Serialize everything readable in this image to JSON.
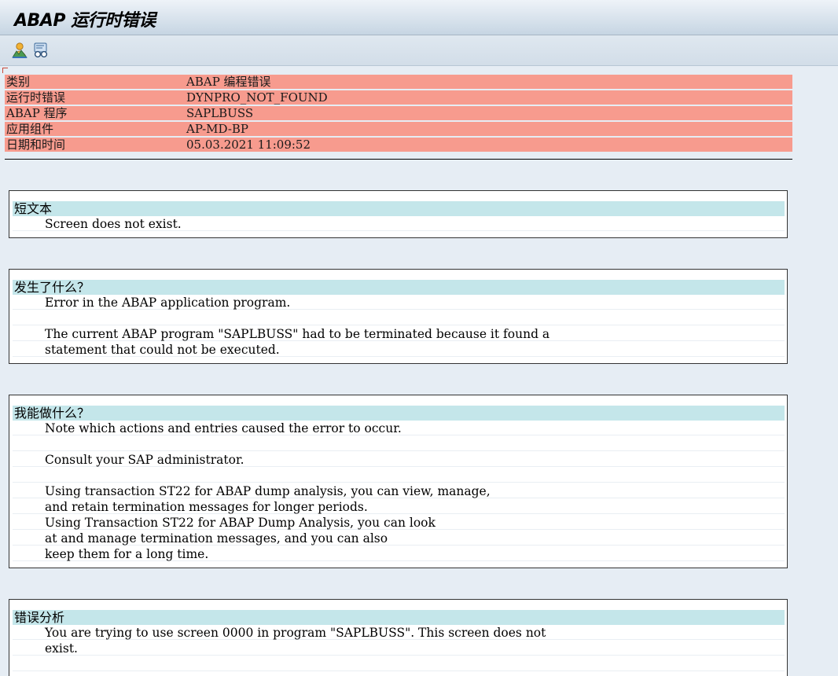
{
  "window": {
    "title": "ABAP 运行时错误"
  },
  "toolbar": {
    "buttons": [
      {
        "icon": "user-tree-icon"
      },
      {
        "icon": "glasses-display-icon"
      }
    ]
  },
  "header": {
    "rows": [
      {
        "key": "类别",
        "value": "ABAP 编程错误"
      },
      {
        "key": "运行时错误",
        "value": "DYNPRO_NOT_FOUND"
      },
      {
        "key": "ABAP 程序",
        "value": "SAPLBUSS"
      },
      {
        "key": "应用组件",
        "value": "AP-MD-BP"
      },
      {
        "key": "日期和时间",
        "value": "05.03.2021 11:09:52"
      }
    ]
  },
  "sections": [
    {
      "title": "短文本",
      "lines": [
        "Screen does not exist."
      ]
    },
    {
      "title": "发生了什么？",
      "lines": [
        "Error in the ABAP application program.",
        "",
        "The current ABAP program \"SAPLBUSS\" had to be terminated because it found a",
        "statement that could not be executed."
      ]
    },
    {
      "title": "我能做什么？",
      "lines": [
        "Note which actions and entries caused the error to occur.",
        "",
        "Consult your SAP administrator.",
        "",
        "Using transaction ST22 for ABAP dump analysis, you can view, manage,",
        "and retain termination messages for longer periods.",
        "Using Transaction ST22 for ABAP Dump Analysis, you can look",
        "at and manage termination messages, and you can also",
        "keep them for a long time."
      ]
    },
    {
      "title": "错误分析",
      "lines": [
        "You are trying to use screen 0000 in program \"SAPLBUSS\". This screen does not",
        "exist.",
        ""
      ]
    }
  ],
  "colors": {
    "header_row_bg": "#f79b8e",
    "section_head_bg": "#c4e6ea",
    "page_bg": "#e6edf4"
  }
}
